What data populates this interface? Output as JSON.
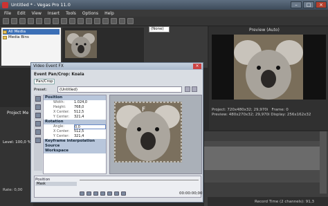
{
  "window": {
    "title": "Untitled * - Vegas Pro 11.0"
  },
  "menu": [
    "File",
    "Edit",
    "View",
    "Insert",
    "Tools",
    "Options",
    "Help"
  ],
  "explorer": {
    "items": [
      {
        "label": "All Media"
      },
      {
        "label": "Media Bins"
      }
    ]
  },
  "trimmer": {
    "dropdown_value": "(None)"
  },
  "preview": {
    "label": "Preview (Auto)",
    "info": {
      "project": "720x480x32; 29,970i",
      "preview": "480x270x32; 29,970i",
      "frame": "0",
      "display": "256x162x32"
    }
  },
  "timeline": {
    "project_label": "Project Me",
    "level": "Level: 100,0 %",
    "rate": "Rate: 0,00",
    "record_time": "Record Time (2 channels): 91,3"
  },
  "dialog": {
    "title": "Video Event FX",
    "header": "Event Pan/Crop:  Koala",
    "tab": "Pan/Crop",
    "preset_label": "Preset:",
    "preset_value": "(Untitled)",
    "sections": {
      "position": "Position",
      "rotation": "Rotation",
      "keyframe": "Keyframe interpolation",
      "source": "Source",
      "workspace": "Workspace"
    },
    "position_rows": [
      {
        "k": "Width:",
        "v": "1.024,0"
      },
      {
        "k": "Height:",
        "v": "768,0"
      },
      {
        "k": "X Center:",
        "v": "512,5"
      },
      {
        "k": "Y Center:",
        "v": "321,4"
      }
    ],
    "rotation_rows": [
      {
        "k": "Angle:",
        "v": "0,0"
      },
      {
        "k": "X Center:",
        "v": "512,5"
      },
      {
        "k": "Y Center:",
        "v": "321,4"
      }
    ],
    "timeline_label": "Position",
    "track_label": "Mask",
    "time": "00:00:00;00"
  }
}
